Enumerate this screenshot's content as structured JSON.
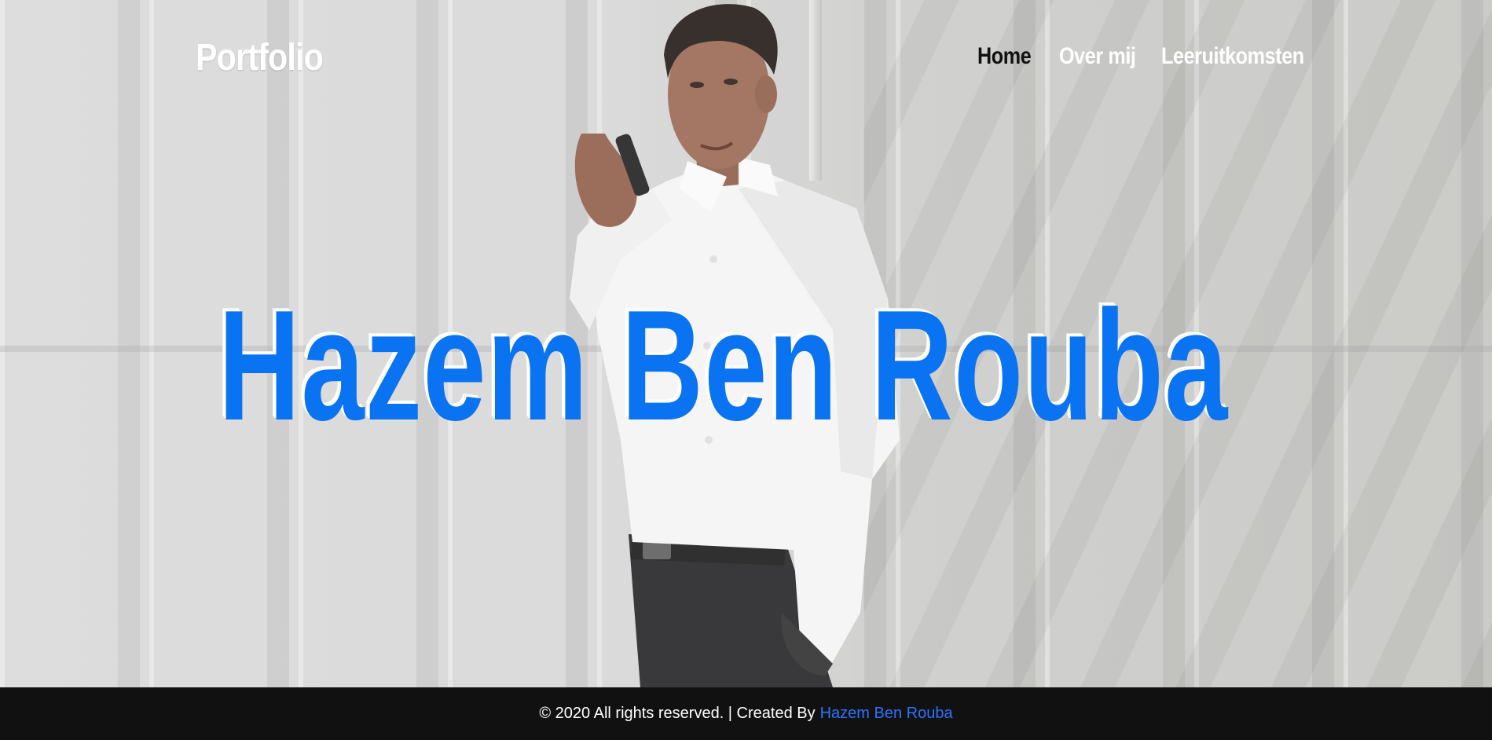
{
  "brand": {
    "logo_text": "Portfolio"
  },
  "nav": {
    "items": [
      {
        "label": "Home",
        "active": true
      },
      {
        "label": "Over mij",
        "active": false
      },
      {
        "label": "Leeruitkomsten",
        "active": false
      }
    ]
  },
  "hero": {
    "title": "Hazem Ben Rouba",
    "title_color": "#0a73f2"
  },
  "footer": {
    "text": "© 2020 All rights reserved. | Created By",
    "link_text": "Hazem Ben Rouba",
    "link_color": "#2b74ff",
    "background": "#111111"
  }
}
